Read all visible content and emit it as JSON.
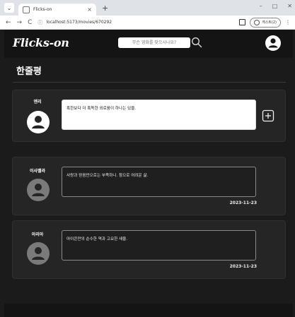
{
  "browser": {
    "tab_title": "Flicks-on",
    "tab_close": "×",
    "new_tab": "+",
    "minimize": "–",
    "maximize": "□",
    "close": "✕",
    "back": "←",
    "forward": "→",
    "reload": "C",
    "url": "localhost:5173/movies/670292",
    "profile_label": "게스트(2)",
    "menu": "⋮"
  },
  "app": {
    "logo": "Flicks-on",
    "search_placeholder": "무슨 영화를 찾으시나요?"
  },
  "page": {
    "title": "한줄평"
  },
  "compose": {
    "user": "엔리",
    "text": "혹한보다 더 혹독한 외로움이 하나는 있을."
  },
  "reviews": [
    {
      "user": "이사벨라",
      "text": "사랑과 믿음만으로는 부족하니. 참으로 어려운 삶.",
      "date": "2023-11-23"
    },
    {
      "user": "아리아",
      "text": "아이콘만의 순수한 역과 고요한 새울.",
      "date": "2023-11-23"
    }
  ],
  "colors": {
    "background": "#1b1b1b",
    "card": "#252525",
    "header": "#141414",
    "text": "#ffffff",
    "avatar_default": "#7a7a7a"
  }
}
